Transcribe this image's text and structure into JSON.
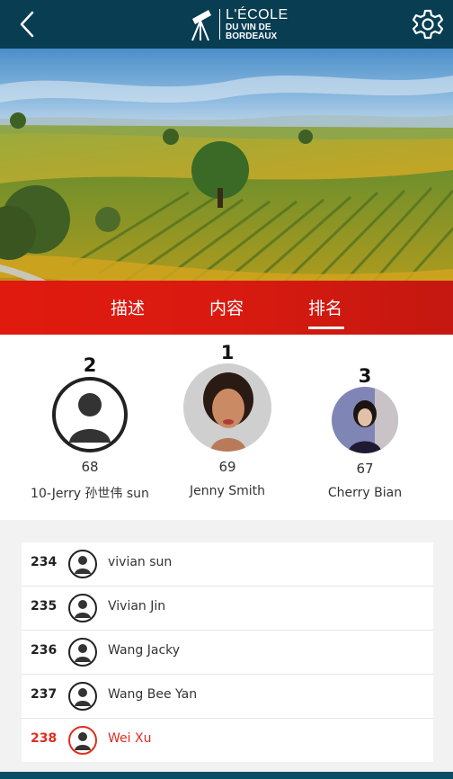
{
  "header": {
    "logo_line1": "L'ÉCOLE",
    "logo_line2": "DU VIN DE",
    "logo_line3": "BORDEAUX",
    "colors": {
      "bar": "#083d52"
    }
  },
  "tabs": [
    {
      "label": "描述",
      "active": false
    },
    {
      "label": "内容",
      "active": false
    },
    {
      "label": "排名",
      "active": true
    }
  ],
  "podium": [
    {
      "rank": "2",
      "score": "68",
      "name": "10-Jerry 孙世伟 sun",
      "avatar": "default-avatar-icon"
    },
    {
      "rank": "1",
      "score": "69",
      "name": "Jenny Smith",
      "avatar": "photo"
    },
    {
      "rank": "3",
      "score": "67",
      "name": "Cherry Bian",
      "avatar": "photo"
    }
  ],
  "ranking_list": [
    {
      "rank": "234",
      "name": "vivian sun",
      "highlight": false
    },
    {
      "rank": "235",
      "name": "Vivian Jin",
      "highlight": false
    },
    {
      "rank": "236",
      "name": "Wang Jacky",
      "highlight": false
    },
    {
      "rank": "237",
      "name": "Wang Bee Yan",
      "highlight": false
    },
    {
      "rank": "238",
      "name": "Wei Xu",
      "highlight": true,
      "color": "#e02d1f"
    }
  ]
}
